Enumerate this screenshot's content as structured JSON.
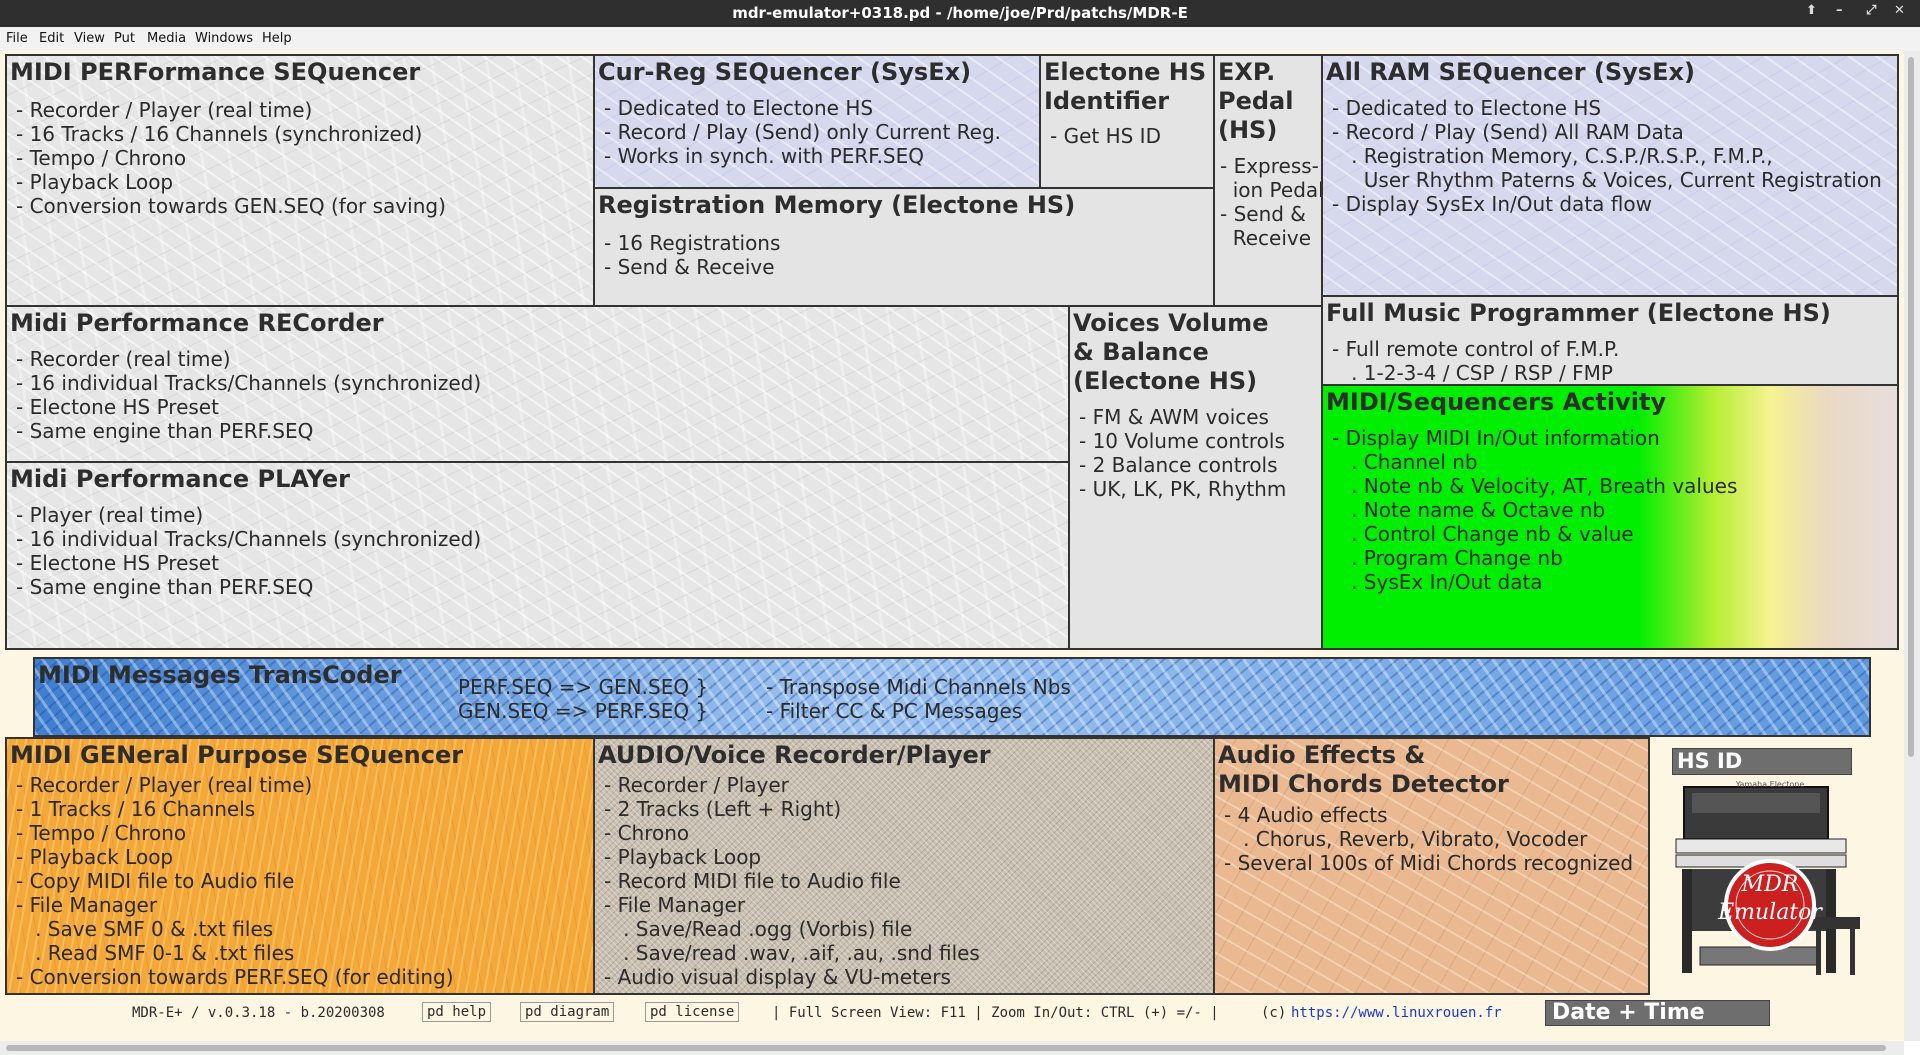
{
  "window": {
    "title": "mdr-emulator+0318.pd  - /home/joe/Prd/patchs/MDR-E",
    "controls": [
      "⬆",
      "–",
      "⤢",
      "✕"
    ]
  },
  "menu": [
    "File",
    "Edit",
    "View",
    "Put",
    "Media",
    "Windows",
    "Help"
  ],
  "panels": {
    "perf_seq": {
      "title": "MIDI PERFormance SEQuencer",
      "items": [
        "- Recorder / Player (real time)",
        "- 16 Tracks / 16 Channels (synchronized)",
        "- Tempo / Chrono",
        "- Playback Loop",
        "- Conversion towards GEN.SEQ (for saving)"
      ]
    },
    "cur_reg": {
      "title": "Cur-Reg SEQuencer (SysEx)",
      "items": [
        "- Dedicated to Electone HS",
        "- Record / Play (Send) only Current Reg.",
        "- Works in synch. with PERF.SEQ"
      ]
    },
    "hs_identifier": {
      "title": "Electone HS\nIdentifier",
      "items": [
        "- Get HS ID"
      ]
    },
    "exp_pedal": {
      "title": "EXP.\nPedal\n(HS)",
      "items": [
        "- Express-",
        "  ion Pedal",
        "- Send &",
        "  Receive"
      ]
    },
    "all_ram": {
      "title": "All RAM SEQuencer (SysEx)",
      "items": [
        "- Dedicated to Electone HS",
        "- Record / Play (Send) All RAM Data",
        "   . Registration Memory, C.S.P./R.S.P., F.M.P.,",
        "     User Rhythm Paterns & Voices, Current Registration",
        "- Display SysEx In/Out data flow"
      ]
    },
    "reg_memory": {
      "title": "Registration Memory (Electone HS)",
      "items": [
        "- 16 Registrations",
        "- Send & Receive"
      ]
    },
    "perf_rec": {
      "title": "Midi Performance RECorder",
      "items": [
        "- Recorder (real time)",
        "- 16 individual Tracks/Channels (synchronized)",
        "- Electone HS Preset",
        "- Same engine than PERF.SEQ"
      ]
    },
    "voices": {
      "title": "Voices Volume\n& Balance\n(Electone HS)",
      "items": [
        "- FM & AWM voices",
        "- 10 Volume controls",
        "- 2 Balance controls",
        "- UK, LK, PK, Rhythm"
      ]
    },
    "fmp": {
      "title": "Full Music Programmer (Electone HS)",
      "items": [
        "- Full remote control of F.M.P.",
        "   . 1-2-3-4 / CSP / RSP / FMP"
      ]
    },
    "activity": {
      "title": "MIDI/Sequencers Activity",
      "items": [
        "- Display MIDI In/Out information",
        "   . Channel nb",
        "   . Note nb & Velocity, AT, Breath values",
        "   . Note name & Octave nb",
        "   . Control Change nb & value",
        "   . Program Change nb",
        "   . SysEx In/Out data"
      ]
    },
    "perf_play": {
      "title": "Midi Performance PLAYer",
      "items": [
        "- Player (real time)",
        "- 16 individual Tracks/Channels (synchronized)",
        "- Electone HS Preset",
        "- Same engine than PERF.SEQ"
      ]
    },
    "transcoder": {
      "title": "MIDI Messages TransCoder",
      "left_lines": [
        "PERF.SEQ => GEN.SEQ }",
        "GEN.SEQ => PERF.SEQ }"
      ],
      "right_lines": [
        "- Transpose Midi Channels Nbs",
        "- Filter CC & PC Messages"
      ]
    },
    "gen_seq": {
      "title": "MIDI GENeral Purpose SEQuencer",
      "items": [
        "- Recorder / Player (real time)",
        "- 1 Tracks / 16 Channels",
        "- Tempo / Chrono",
        "- Playback Loop",
        "- Copy MIDI file to Audio file",
        "- File Manager",
        "   . Save SMF 0 & .txt files",
        "   . Read SMF 0-1 & .txt files",
        "- Conversion towards PERF.SEQ (for editing)"
      ]
    },
    "audio_rec": {
      "title": "AUDIO/Voice Recorder/Player",
      "items": [
        "- Recorder / Player",
        "- 2 Tracks (Left + Right)",
        "- Chrono",
        "- Playback Loop",
        "- Record MIDI file to Audio file",
        "- File Manager",
        "   . Save/Read .ogg (Vorbis) file",
        "   . Save/read .wav, .aif, .au, .snd files",
        "- Audio visual display & VU-meters"
      ]
    },
    "effects": {
      "title": "Audio Effects &\nMIDI Chords Detector",
      "items": [
        "- 4 Audio effects",
        "   . Chorus, Reverb, Vibrato, Vocoder",
        "- Several 100s of Midi Chords recognized"
      ]
    }
  },
  "hs_id_label": "HS ID",
  "logo": {
    "top": "MDR",
    "bottom": "Emulator",
    "ring": "Yamaha Electone"
  },
  "status": {
    "version": "MDR-E+ / v.0.3.18 - b.20200308",
    "help_btn": "pd help",
    "diagram_btn": "pd diagram",
    "license_btn": "pd license",
    "hint": "| Full Screen View: F11 | Zoom In/Out: CTRL (+) =/- |",
    "copyright": "(c)",
    "url": "https://www.linuxrouen.fr",
    "datetime": "Date + Time"
  },
  "colors": {
    "activity_green": "#00ee00",
    "transcoder_blue": "#4f90dc",
    "gen_orange": "#f5a83a",
    "lavender": "#d6d8ee"
  }
}
